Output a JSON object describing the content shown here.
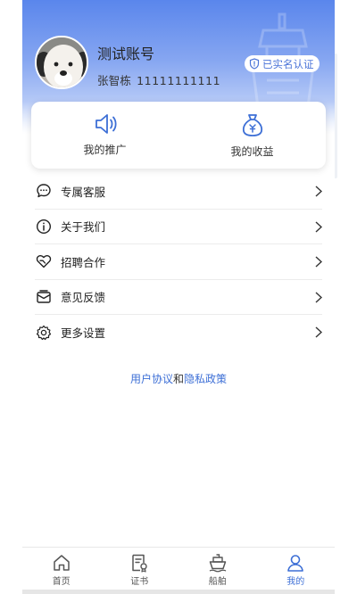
{
  "profile": {
    "name": "测试账号",
    "real_name": "张智栋",
    "uid": "11111111111",
    "verify_label": "已实名认证"
  },
  "quick_actions": [
    {
      "label": "我的推广",
      "icon": "speaker-icon"
    },
    {
      "label": "我的收益",
      "icon": "money-bag-icon"
    }
  ],
  "menu": [
    {
      "label": "专属客服",
      "icon": "service-chat-icon"
    },
    {
      "label": "关于我们",
      "icon": "info-icon"
    },
    {
      "label": "招聘合作",
      "icon": "handshake-heart-icon"
    },
    {
      "label": "意见反馈",
      "icon": "feedback-mail-icon"
    },
    {
      "label": "更多设置",
      "icon": "gear-icon"
    }
  ],
  "agreement": {
    "user_agreement": "用户协议",
    "and": "和",
    "privacy_policy": "隐私政策"
  },
  "tabbar": [
    {
      "label": "首页",
      "icon": "home-icon",
      "active": false
    },
    {
      "label": "证书",
      "icon": "certificate-icon",
      "active": false
    },
    {
      "label": "船舶",
      "icon": "ship-icon",
      "active": false
    },
    {
      "label": "我的",
      "icon": "user-icon",
      "active": true
    }
  ],
  "colors": {
    "accent": "#3d6fd6",
    "header_top": "#5a86ec"
  }
}
